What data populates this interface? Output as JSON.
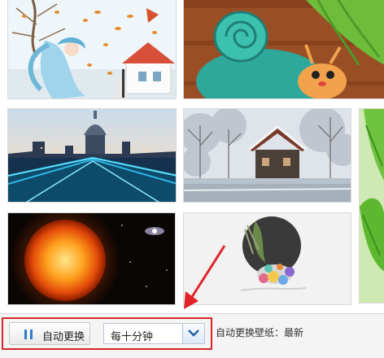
{
  "thumbnails": [
    {
      "name": "thumb-autumn-girl-illustration",
      "subject": "autumn illustration of a girl with blowing hair and a red-roofed house"
    },
    {
      "name": "thumb-snail-illustration",
      "subject": "cartoon teal snail with a smiling snail on wood background"
    },
    {
      "name": "thumb-london-night",
      "subject": "St Paul's Cathedral and Millennium Bridge at dusk"
    },
    {
      "name": "thumb-winter-cabin",
      "subject": "snowy cabin by a frozen lake"
    },
    {
      "name": "thumb-edge-green",
      "subject": "partially visible green leaves image"
    },
    {
      "name": "thumb-sun",
      "subject": "burning sun in space"
    },
    {
      "name": "thumb-ink-art",
      "subject": "minimal ink art with colourful figures in a circle"
    }
  ],
  "controls": {
    "auto_change_label": "自动更换",
    "interval_value": "每十分钟",
    "status": "自动更换壁纸：最新"
  },
  "colors": {
    "highlight_frame": "#d5262b",
    "pause_icon": "#2f7ec9"
  }
}
